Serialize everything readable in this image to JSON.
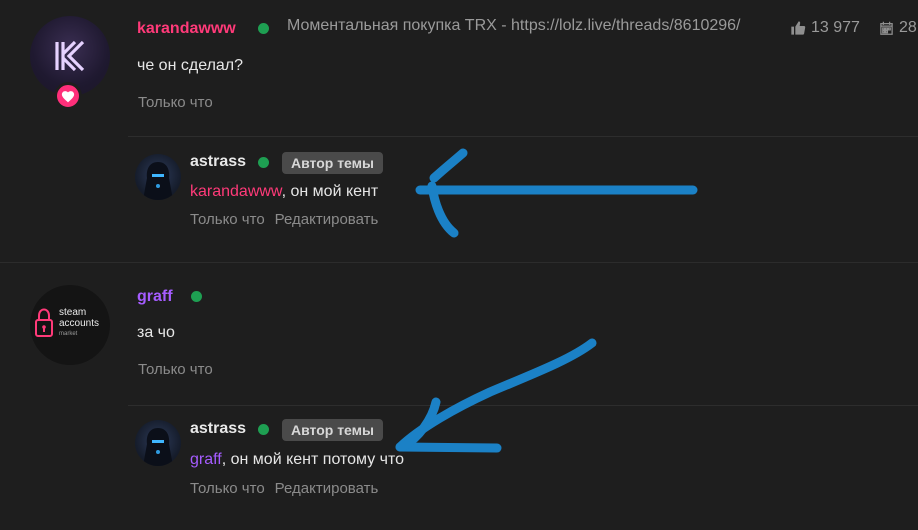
{
  "posts": [
    {
      "author": "karandawww",
      "status": "Моментальная покупка TRX - https://lolz.live/threads/8610296/",
      "likes": "13 977",
      "stat2": "28",
      "message": "че он сделал?",
      "time": "Только что",
      "reply": {
        "author": "astrass",
        "badge": "Автор темы",
        "mention": "karandawww",
        "text": ", он мой кент",
        "time": "Только что",
        "edit": "Редактировать"
      }
    },
    {
      "author": "graff",
      "avatar_text": [
        "steam",
        "accounts",
        "market"
      ],
      "message": "за чо",
      "time": "Только что",
      "reply": {
        "author": "astrass",
        "badge": "Автор темы",
        "mention": "graff",
        "text": ", он мой кент потому что",
        "time": "Только что",
        "edit": "Редактировать"
      }
    }
  ],
  "colors": {
    "background": "#1e1e1e",
    "author_pink": "#ff3a79",
    "author_purple": "#a55cff",
    "online": "#1e9f52",
    "annotation": "#1b87d0"
  },
  "icons": [
    "heart-icon",
    "thumbs-up-icon",
    "calendar-icon",
    "lock-icon"
  ]
}
